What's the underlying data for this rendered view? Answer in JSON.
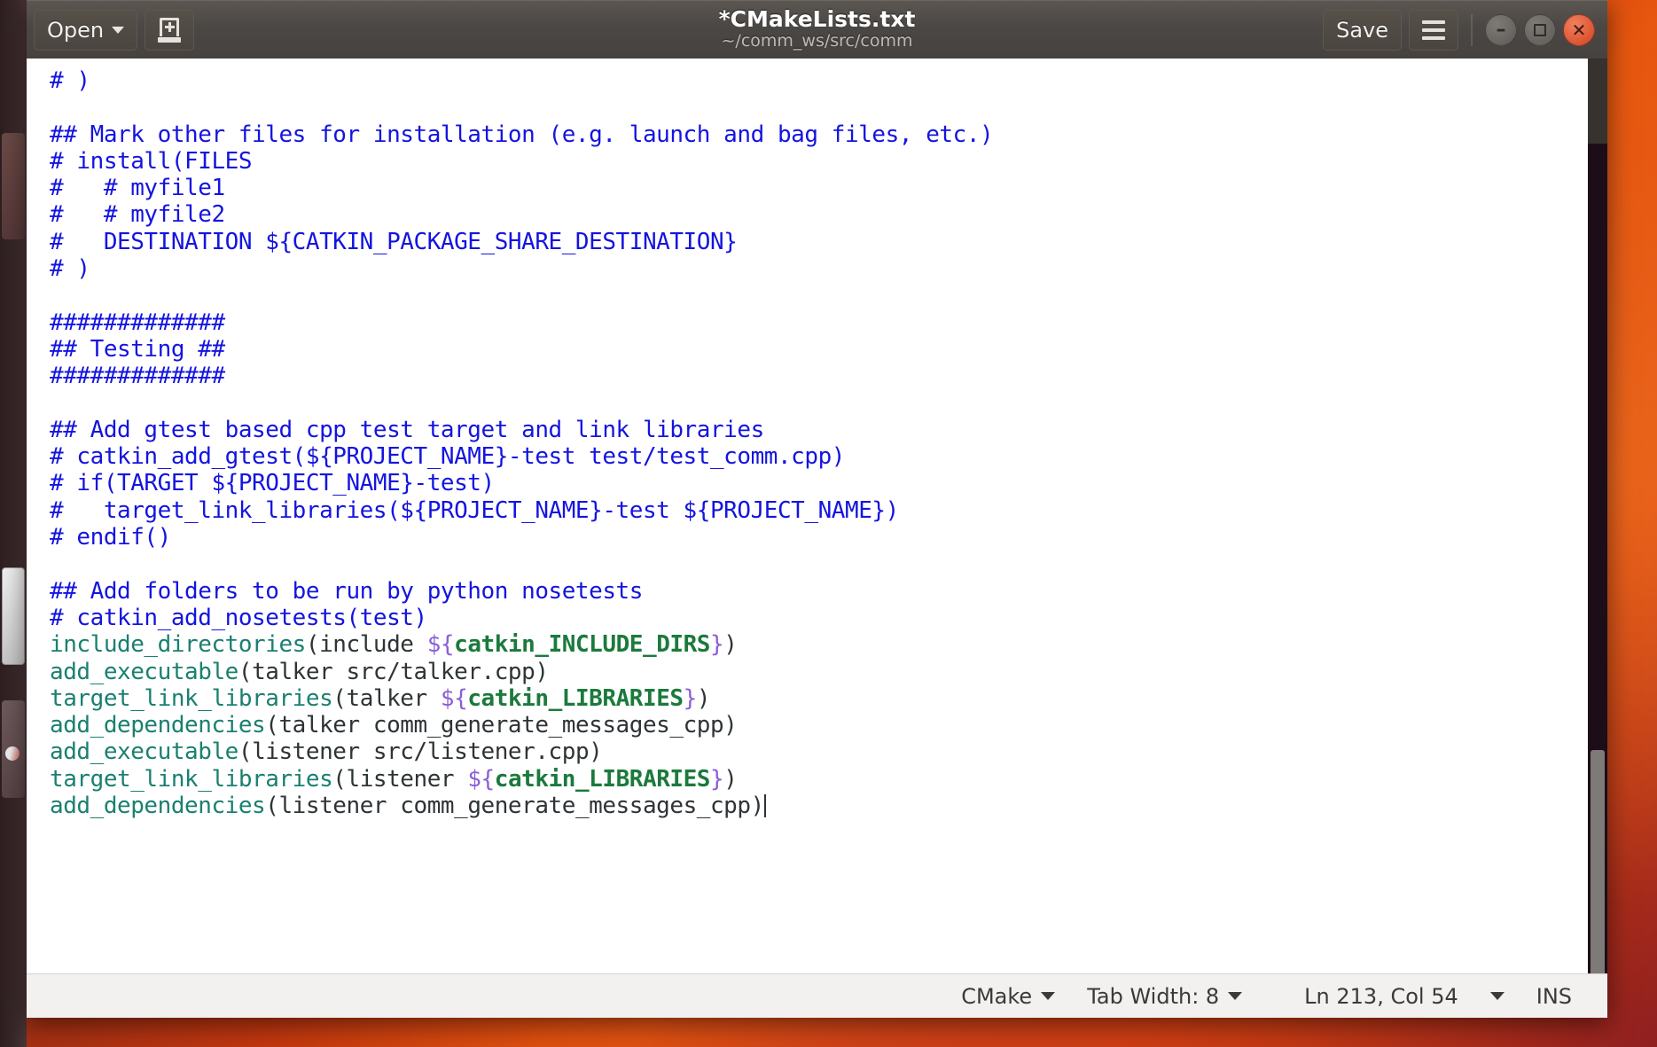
{
  "window": {
    "title": "*CMakeLists.txt",
    "subtitle": "~/comm_ws/src/comm"
  },
  "header": {
    "open_label": "Open",
    "save_label": "Save",
    "new_doc_icon": "new-document-icon",
    "menu_icon": "hamburger-menu-icon",
    "open_caret_icon": "chevron-down-icon",
    "minimize_glyph": "–",
    "close_glyph": "✕"
  },
  "statusbar": {
    "language": "CMake",
    "tab_width": "Tab Width: 8",
    "position": "Ln 213, Col 54",
    "mode": "INS",
    "language_caret_icon": "chevron-down-icon",
    "tab_caret_icon": "chevron-down-icon",
    "position_caret_icon": "chevron-down-icon"
  },
  "colors": {
    "comment": "#1414e0",
    "function": "#1a8070",
    "variable": "#1b7a3c",
    "delimiter": "#8a5fd6",
    "plain": "#2e3436",
    "accent": "#d3421c"
  },
  "editor": {
    "lines": [
      [
        {
          "t": "# )",
          "c": "cm"
        }
      ],
      [
        {
          "t": "",
          "c": "pl"
        }
      ],
      [
        {
          "t": "## Mark other files for installation (e.g. launch and bag files, etc.)",
          "c": "cm"
        }
      ],
      [
        {
          "t": "# install(FILES",
          "c": "cm"
        }
      ],
      [
        {
          "t": "#   # myfile1",
          "c": "cm"
        }
      ],
      [
        {
          "t": "#   # myfile2",
          "c": "cm"
        }
      ],
      [
        {
          "t": "#   DESTINATION ${CATKIN_PACKAGE_SHARE_DESTINATION}",
          "c": "cm"
        }
      ],
      [
        {
          "t": "# )",
          "c": "cm"
        }
      ],
      [
        {
          "t": "",
          "c": "pl"
        }
      ],
      [
        {
          "t": "#############",
          "c": "cm"
        }
      ],
      [
        {
          "t": "## Testing ##",
          "c": "cm"
        }
      ],
      [
        {
          "t": "#############",
          "c": "cm"
        }
      ],
      [
        {
          "t": "",
          "c": "pl"
        }
      ],
      [
        {
          "t": "## Add gtest based cpp test target and link libraries",
          "c": "cm"
        }
      ],
      [
        {
          "t": "# catkin_add_gtest(${PROJECT_NAME}-test test/test_comm.cpp)",
          "c": "cm"
        }
      ],
      [
        {
          "t": "# if(TARGET ${PROJECT_NAME}-test)",
          "c": "cm"
        }
      ],
      [
        {
          "t": "#   target_link_libraries(${PROJECT_NAME}-test ${PROJECT_NAME})",
          "c": "cm"
        }
      ],
      [
        {
          "t": "# endif()",
          "c": "cm"
        }
      ],
      [
        {
          "t": "",
          "c": "pl"
        }
      ],
      [
        {
          "t": "## Add folders to be run by python nosetests",
          "c": "cm"
        }
      ],
      [
        {
          "t": "# catkin_add_nosetests(test)",
          "c": "cm"
        }
      ],
      [
        {
          "t": "include_directories",
          "c": "fn"
        },
        {
          "t": "(include ",
          "c": "pl"
        },
        {
          "t": "${",
          "c": "dl"
        },
        {
          "t": "catkin_INCLUDE_DIRS",
          "c": "var"
        },
        {
          "t": "}",
          "c": "dl"
        },
        {
          "t": ")",
          "c": "pl"
        }
      ],
      [
        {
          "t": "add_executable",
          "c": "fn"
        },
        {
          "t": "(talker src/talker.cpp)",
          "c": "pl"
        }
      ],
      [
        {
          "t": "target_link_libraries",
          "c": "fn"
        },
        {
          "t": "(talker ",
          "c": "pl"
        },
        {
          "t": "${",
          "c": "dl"
        },
        {
          "t": "catkin_LIBRARIES",
          "c": "var"
        },
        {
          "t": "}",
          "c": "dl"
        },
        {
          "t": ")",
          "c": "pl"
        }
      ],
      [
        {
          "t": "add_dependencies",
          "c": "fn"
        },
        {
          "t": "(talker comm_generate_messages_cpp)",
          "c": "pl"
        }
      ],
      [
        {
          "t": "add_executable",
          "c": "fn"
        },
        {
          "t": "(listener src/listener.cpp)",
          "c": "pl"
        }
      ],
      [
        {
          "t": "target_link_libraries",
          "c": "fn"
        },
        {
          "t": "(listener ",
          "c": "pl"
        },
        {
          "t": "${",
          "c": "dl"
        },
        {
          "t": "catkin_LIBRARIES",
          "c": "var"
        },
        {
          "t": "}",
          "c": "dl"
        },
        {
          "t": ")",
          "c": "pl"
        }
      ],
      [
        {
          "t": "add_dependencies",
          "c": "fn"
        },
        {
          "t": "(listener comm_generate_messages_cpp)",
          "c": "pl"
        },
        {
          "t": "CARET",
          "c": "caret"
        }
      ]
    ]
  }
}
